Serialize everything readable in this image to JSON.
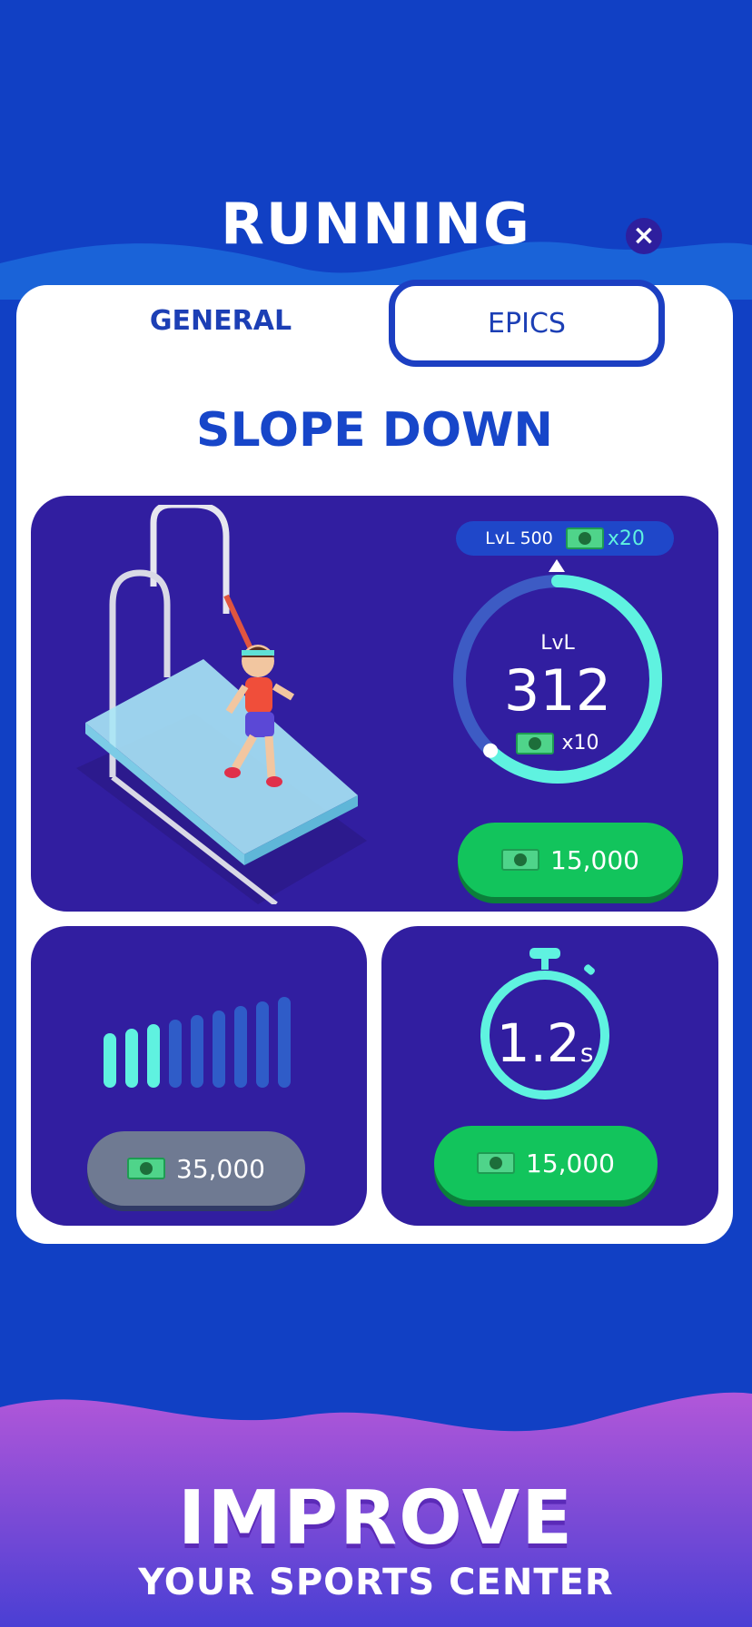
{
  "header": {
    "title": "RUNNING",
    "close_icon": "close-icon"
  },
  "tabs": [
    {
      "label": "GENERAL",
      "active": true
    },
    {
      "label": "EPICS",
      "active": false
    }
  ],
  "equipment": {
    "name": "SLOPE DOWN"
  },
  "level": {
    "milestone_label": "LvL 500",
    "milestone_reward": "x20",
    "label": "LvL",
    "value": "312",
    "reward": "x10",
    "progress_fraction": 0.62,
    "upgrade_cost": "15,000"
  },
  "capacity": {
    "bars_total": 9,
    "bars_filled": 3,
    "upgrade_cost": "35,000",
    "affordable": false
  },
  "speed": {
    "value": "1.2",
    "unit": "s",
    "upgrade_cost": "15,000"
  },
  "promo": {
    "title": "IMPROVE",
    "subtitle": "YOUR SPORTS CENTER"
  },
  "colors": {
    "background": "#1140c4",
    "card": "#311ea0",
    "accent": "#5ff2e0",
    "button_green": "#12c45c",
    "button_disabled": "#6f7a92"
  }
}
